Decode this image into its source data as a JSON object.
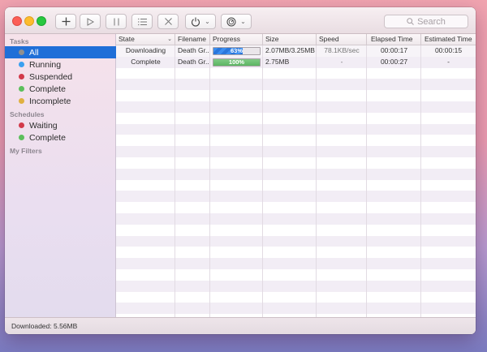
{
  "toolbar": {
    "search_placeholder": "Search"
  },
  "sidebar": {
    "tasks_header": "Tasks",
    "tasks": [
      {
        "label": "All",
        "color": "#8f8f8f",
        "selected": true
      },
      {
        "label": "Running",
        "color": "#3aa0f0"
      },
      {
        "label": "Suspended",
        "color": "#d23a4a"
      },
      {
        "label": "Complete",
        "color": "#5cbf5c"
      },
      {
        "label": "Incomplete",
        "color": "#e0b040"
      }
    ],
    "schedules_header": "Schedules",
    "schedules": [
      {
        "label": "Waiting",
        "color": "#d23a4a"
      },
      {
        "label": "Complete",
        "color": "#5cbf5c"
      }
    ],
    "filters_header": "My Filters"
  },
  "table": {
    "columns": [
      "State",
      "Filename",
      "Progress",
      "Size",
      "Speed",
      "Elapsed Time",
      "Estimated Time"
    ],
    "rows": [
      {
        "state": "Downloading",
        "filename": "Death Gr...",
        "progress": "63%",
        "progress_value": 0.63,
        "progress_color": "blue",
        "size": "2.07MB/3.25MB",
        "speed": "78.1KB/sec",
        "elapsed": "00:00:17",
        "estimated": "00:00:15"
      },
      {
        "state": "Complete",
        "filename": "Death Gr...",
        "progress": "100%",
        "progress_value": 1.0,
        "progress_color": "green",
        "size": "2.75MB",
        "speed": "-",
        "elapsed": "00:00:27",
        "estimated": "-"
      }
    ]
  },
  "status": {
    "text": "Downloaded: 5.56MB"
  }
}
